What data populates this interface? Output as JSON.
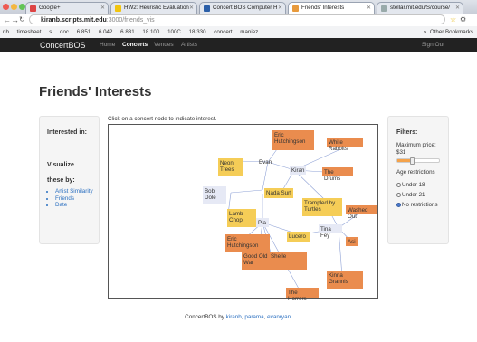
{
  "browser": {
    "tabs": [
      {
        "label": "Google+"
      },
      {
        "label": "HW2: Heuristic Evaluation"
      },
      {
        "label": "Concert BOS Computer H"
      },
      {
        "label": "Friends' Interests"
      },
      {
        "label": "stellar.mit.edu/S/course/"
      }
    ],
    "url_host": "kiranb.scripts.mit.edu",
    "url_path": ":3000/friends_vis",
    "bookmarks": [
      "nb",
      "timesheet",
      "s",
      "doc",
      "6.851",
      "6.042",
      "6.831",
      "18.100",
      "100C",
      "18.330",
      "concert",
      "maniez"
    ],
    "bookmarks_right": "Other Bookmarks"
  },
  "nav": {
    "brand": "ConcertBOS",
    "links": [
      "Home",
      "Concerts",
      "Venues",
      "Artists"
    ],
    "signout": "Sign Out"
  },
  "page": {
    "title": "Friends' Interests",
    "instruction": "Click on a concert node to indicate interest."
  },
  "sidebar": {
    "interested_label": "Interested in:",
    "visualize_label": "Visualize",
    "these_by_label": "these by:",
    "links": [
      "Artist Similarity",
      "Friends",
      "Date"
    ]
  },
  "filters": {
    "title": "Filters:",
    "max_price_label": "Maximum price:",
    "max_price_value": "$31",
    "slider_fraction": 0.35,
    "age_label": "Age restrictions",
    "age_options": [
      {
        "label": "Under 18",
        "selected": false
      },
      {
        "label": "Under 21",
        "selected": false
      },
      {
        "label": "No restrictions",
        "selected": true
      }
    ]
  },
  "graph": {
    "nodes": {
      "n1": "Eric Hutchingson",
      "n2": "White Rabbits",
      "n3": "Neon Trees",
      "n4": "Evan",
      "n5": "Kiran",
      "n6": "The Drums",
      "n7": "Bob Dole",
      "n8": "Nada Surf",
      "n9": "Trampled by Turtles",
      "n10": "Washed Out",
      "n11": "Lamb Chop",
      "n12": "Pia",
      "n13": "Tina Fey",
      "n14": "Lucero",
      "n15": "Eric Hutchingson",
      "n16": "Asi",
      "n17": "Good Old War",
      "n18": "Shelle",
      "n19": "Kinna Grannis",
      "n20": "The Horrors"
    }
  },
  "footer": {
    "prefix": "ConcertBOS by",
    "authors": [
      "kiranb",
      "parama",
      "evanryan"
    ]
  }
}
